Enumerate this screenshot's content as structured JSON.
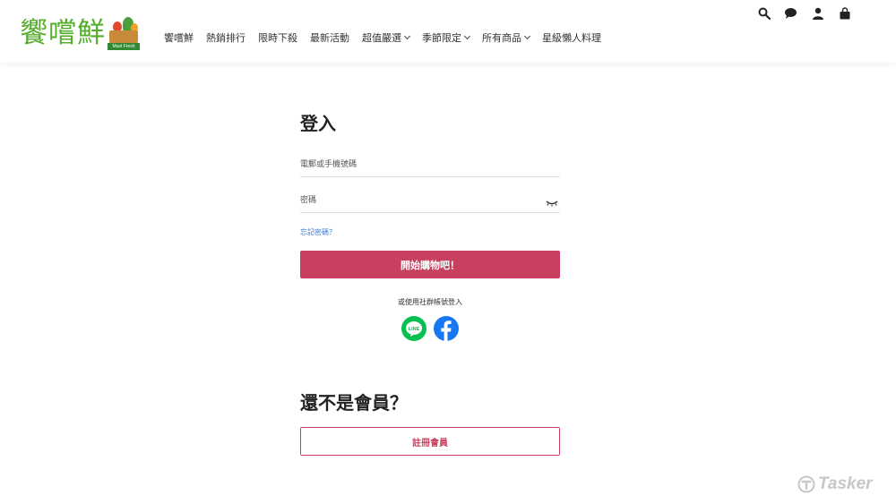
{
  "brand": {
    "name": "饗嚐鮮",
    "tagline": "Must Fresh"
  },
  "nav": {
    "items": [
      {
        "label": "饗嚐鮮",
        "has_dropdown": false
      },
      {
        "label": "熱銷排行",
        "has_dropdown": false
      },
      {
        "label": "限時下殺",
        "has_dropdown": false
      },
      {
        "label": "最新活動",
        "has_dropdown": false
      },
      {
        "label": "超值嚴選",
        "has_dropdown": true
      },
      {
        "label": "季節限定",
        "has_dropdown": true
      },
      {
        "label": "所有商品",
        "has_dropdown": true
      },
      {
        "label": "星級懶人料理",
        "has_dropdown": false
      }
    ]
  },
  "tools": {
    "icons": [
      "search-icon",
      "chat-icon",
      "user-icon",
      "cart-icon"
    ]
  },
  "login": {
    "title": "登入",
    "account_placeholder": "電郵或手機號碼",
    "password_placeholder": "密碼",
    "forgot_label": "忘記密碼？",
    "submit_label": "開始購物吧！",
    "social_label": "或使用社群帳號登入",
    "line_label": "LINE"
  },
  "register": {
    "title": "還不是會員？",
    "button_label": "註冊會員"
  },
  "watermark": {
    "text": "Tasker"
  },
  "colors": {
    "brand_green": "#55ad2c",
    "primary": "#c84060",
    "line_green": "#06c152",
    "facebook_blue": "#1877f2",
    "link_blue": "#3a7bd5"
  }
}
